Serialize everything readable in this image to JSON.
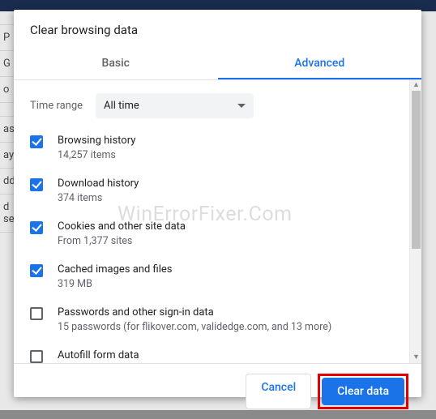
{
  "dialog": {
    "title": "Clear browsing data",
    "tabs": {
      "basic": "Basic",
      "advanced": "Advanced"
    },
    "time_range_label": "Time range",
    "time_range_value": "All time",
    "items": [
      {
        "checked": true,
        "label": "Browsing history",
        "sub": "14,257 items"
      },
      {
        "checked": true,
        "label": "Download history",
        "sub": "374 items"
      },
      {
        "checked": true,
        "label": "Cookies and other site data",
        "sub": "From 1,377 sites"
      },
      {
        "checked": true,
        "label": "Cached images and files",
        "sub": "319 MB"
      },
      {
        "checked": false,
        "label": "Passwords and other sign-in data",
        "sub": "15 passwords (for flikover.com, validedge.com, and 13 more)"
      },
      {
        "checked": false,
        "label": "Autofill form data",
        "sub": ""
      }
    ],
    "buttons": {
      "cancel": "Cancel",
      "clear": "Clear data"
    }
  },
  "bg_labels": [
    "",
    "P",
    "G",
    "o",
    "",
    "as",
    "ay",
    "dd",
    "d security"
  ],
  "watermark": "WinErrorFixer.Com"
}
